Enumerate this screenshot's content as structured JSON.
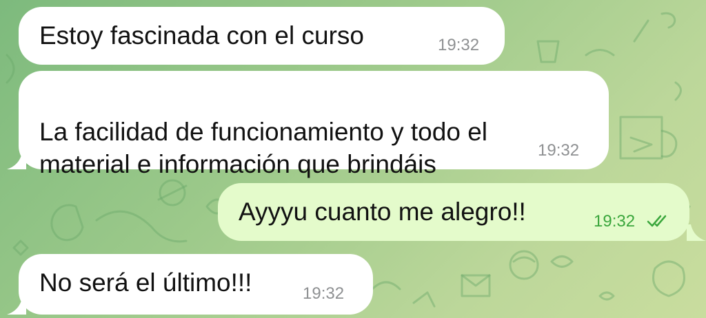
{
  "chat": {
    "messages": [
      {
        "text": "Estoy fascinada con el curso",
        "time": "19:32",
        "direction": "incoming"
      },
      {
        "text": "La facilidad de funcionamiento y todo el\nmaterial e información que brindáis",
        "time": "19:32",
        "direction": "incoming"
      },
      {
        "text": "Ayyyu cuanto me alegro!!",
        "time": "19:32",
        "direction": "outgoing",
        "status": "read",
        "status_icon": "double-check-icon"
      },
      {
        "text": "No será el último!!!",
        "time": "19:32",
        "direction": "incoming"
      }
    ]
  },
  "colors": {
    "incoming_bubble": "#ffffff",
    "outgoing_bubble": "#e4fbcb",
    "outgoing_time": "#3aa63c",
    "incoming_time": "#8e9092",
    "background_start": "#7dba7d",
    "background_end": "#c9dd9e"
  }
}
